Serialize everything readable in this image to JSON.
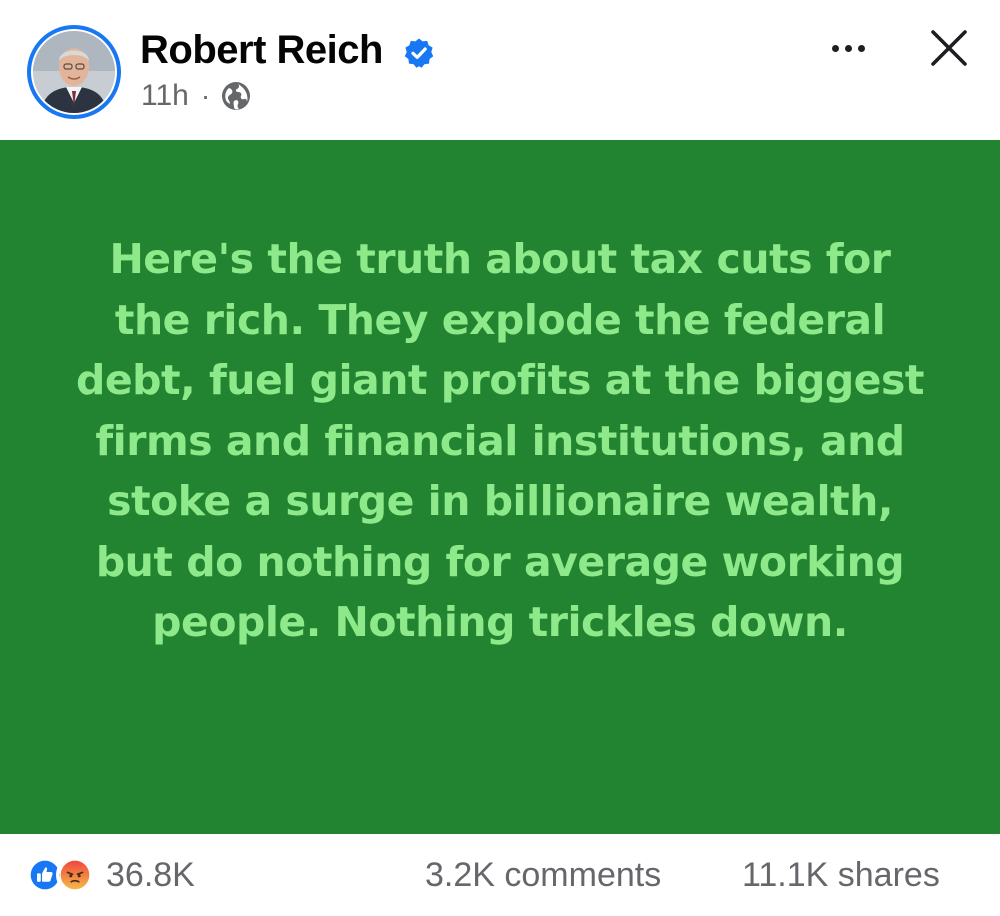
{
  "post": {
    "author": "Robert Reich",
    "timestamp": "11h",
    "separator": "·",
    "audience_icon": "globe-icon",
    "verified_icon": "verified-badge-icon",
    "menu_icon": "more-options-icon",
    "close_icon": "close-icon",
    "text": "Here's the truth about tax cuts for the rich. They explode the federal debt, fuel giant profits at the biggest firms and financial institutions, and stoke a surge in billionaire wealth, but do nothing for average working people. Nothing trickles down.",
    "background_color": "#228430",
    "text_color": "#8ee98a"
  },
  "stats": {
    "reaction_icons": [
      "like-icon",
      "angry-icon"
    ],
    "reactions_count": "36.8K",
    "comments": "3.2K comments",
    "shares": "11.1K shares"
  },
  "colors": {
    "brand_blue": "#1877f2",
    "secondary_text": "#65676b",
    "primary_text": "#050505"
  }
}
